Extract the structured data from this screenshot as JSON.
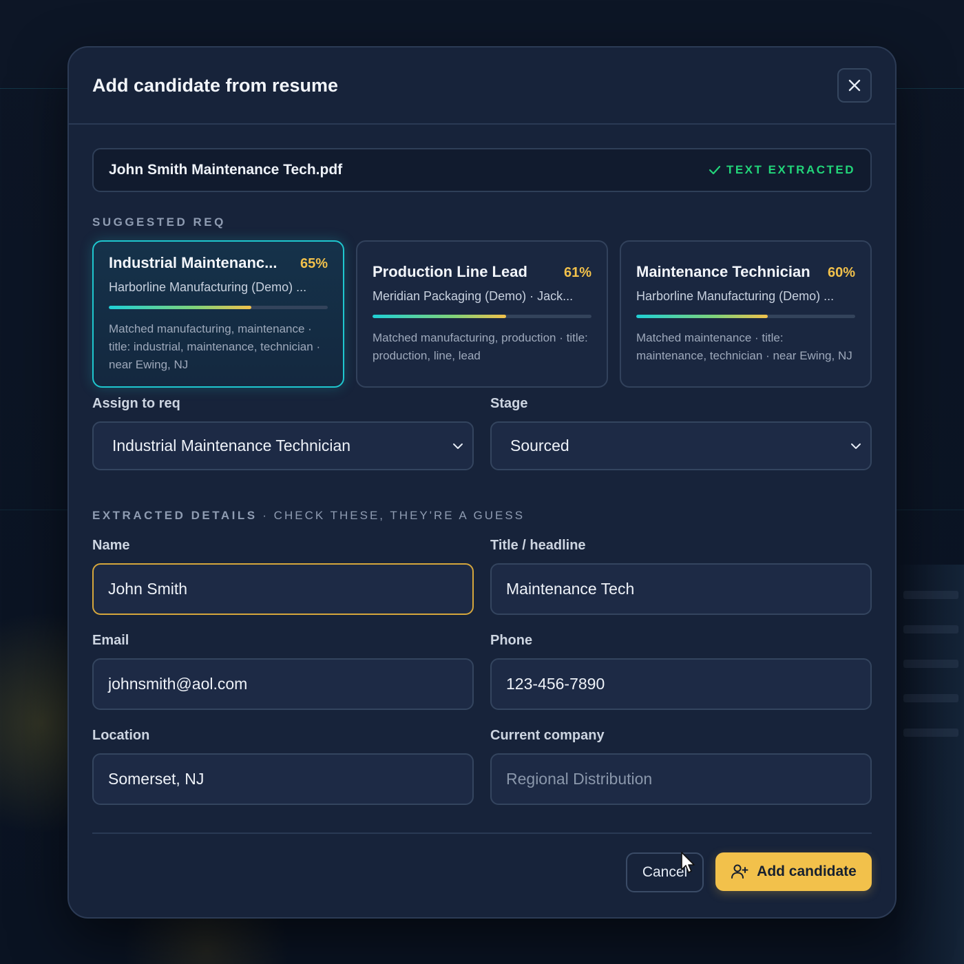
{
  "modal": {
    "title": "Add candidate from resume",
    "close_icon": "close-icon"
  },
  "file": {
    "name": "John Smith Maintenance Tech.pdf",
    "status": "TEXT EXTRACTED",
    "status_icon": "check-icon",
    "status_color": "#22d67a"
  },
  "suggested": {
    "label": "SUGGESTED REQ",
    "cards": [
      {
        "title": "Industrial Maintenanc...",
        "percent_label": "65%",
        "match": 0.65,
        "company": "Harborline Manufacturing (Demo) ...",
        "matched": "Matched manufacturing, maintenance · title: industrial, maintenance, technician · near Ewing, NJ",
        "selected": true
      },
      {
        "title": "Production Line Lead",
        "percent_label": "61%",
        "match": 0.61,
        "company": "Meridian Packaging (Demo) · Jack...",
        "matched": "Matched manufacturing, production · title: production, line, lead",
        "selected": false
      },
      {
        "title": "Maintenance Technician",
        "percent_label": "60%",
        "match": 0.6,
        "company": "Harborline Manufacturing (Demo) ...",
        "matched": "Matched maintenance · title: maintenance, technician · near Ewing, NJ",
        "selected": false
      }
    ]
  },
  "assign": {
    "req_label": "Assign to req",
    "req_value": "Industrial Maintenance Technician",
    "stage_label": "Stage",
    "stage_value": "Sourced"
  },
  "extracted": {
    "label": "EXTRACTED DETAILS",
    "sublabel": " · CHECK THESE, THEY'RE A GUESS",
    "name_label": "Name",
    "name_value": "John Smith",
    "title_label": "Title / headline",
    "title_value": "Maintenance Tech",
    "email_label": "Email",
    "email_value": "johnsmith@aol.com",
    "phone_label": "Phone",
    "phone_value": "123-456-7890",
    "location_label": "Location",
    "location_value": "Somerset, NJ",
    "company_label": "Current company",
    "company_placeholder": "Regional Distribution"
  },
  "footer": {
    "cancel_label": "Cancel",
    "add_label": "Add candidate",
    "add_icon": "user-plus-icon"
  },
  "colors": {
    "accent": "#f2c14b",
    "selected_border": "#1fc7cf",
    "focus_border": "#d6a73c",
    "background": "#17233a"
  }
}
